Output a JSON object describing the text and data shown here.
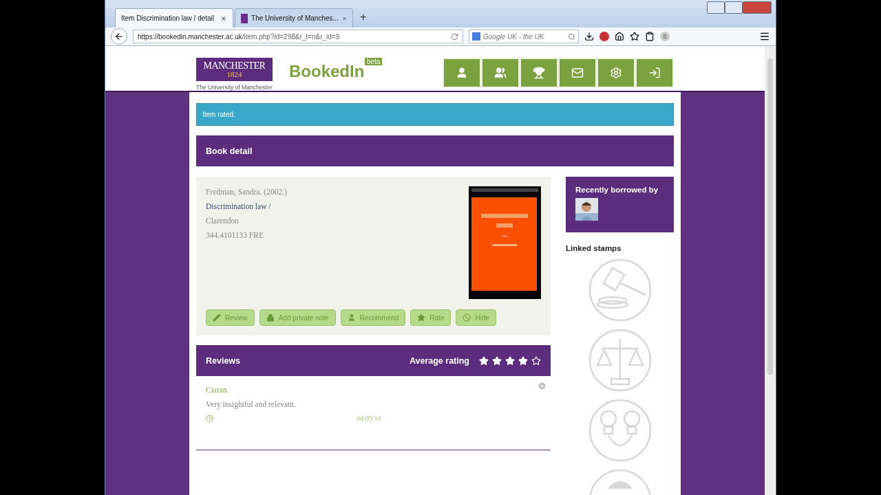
{
  "browser": {
    "tabs": [
      {
        "title": "Item Discrimination law / detail",
        "selected": true,
        "kind": "page"
      },
      {
        "title": "The University of Manches...",
        "selected": false,
        "kind": "university"
      }
    ],
    "new_tab": "+",
    "url_host": "https://bookedin.manchester.ac.uk",
    "url_path": "/item.php?id=298&r_t=n&r_id=9",
    "search_placeholder": "Google UK - the UK",
    "profile_initial": "S"
  },
  "header": {
    "logo_name": "MANCHESTER",
    "logo_year": "1824",
    "logo_caption": "The University of Manchester",
    "app_name": "BookedIn",
    "badge": "beta",
    "nav": [
      {
        "kind": "user"
      },
      {
        "kind": "users"
      },
      {
        "kind": "trophy"
      },
      {
        "kind": "mail"
      },
      {
        "kind": "settings"
      },
      {
        "kind": "sign-in"
      }
    ]
  },
  "alert": "Item rated.",
  "section_title": "Book detail",
  "book": {
    "author": "Fredman, Sandra. (2002.)",
    "title": "Discrimination law /",
    "publisher": "Clarendon",
    "shelfmark": "344.4101133 FRE",
    "actions": [
      {
        "label": "Review",
        "kind": "pencil"
      },
      {
        "label": "Add private note",
        "kind": "lock"
      },
      {
        "label": "Recommend",
        "kind": "user"
      },
      {
        "label": "Rate",
        "kind": "star"
      },
      {
        "label": "Hide",
        "kind": "ban"
      }
    ]
  },
  "reviews": {
    "title": "Reviews",
    "rating_label": "Average rating",
    "stars": 4,
    "items": [
      {
        "author": "Ciaran",
        "text": "Very insightful and relevant.",
        "date": "04/09/14"
      }
    ]
  },
  "sidebar": {
    "borrowed_title": "Recently borrowed by",
    "stamps_title": "Linked stamps",
    "stamps": [
      {
        "kind": "gavel"
      },
      {
        "kind": "scales"
      },
      {
        "kind": "handcuffs"
      },
      {
        "kind": "other"
      }
    ]
  }
}
